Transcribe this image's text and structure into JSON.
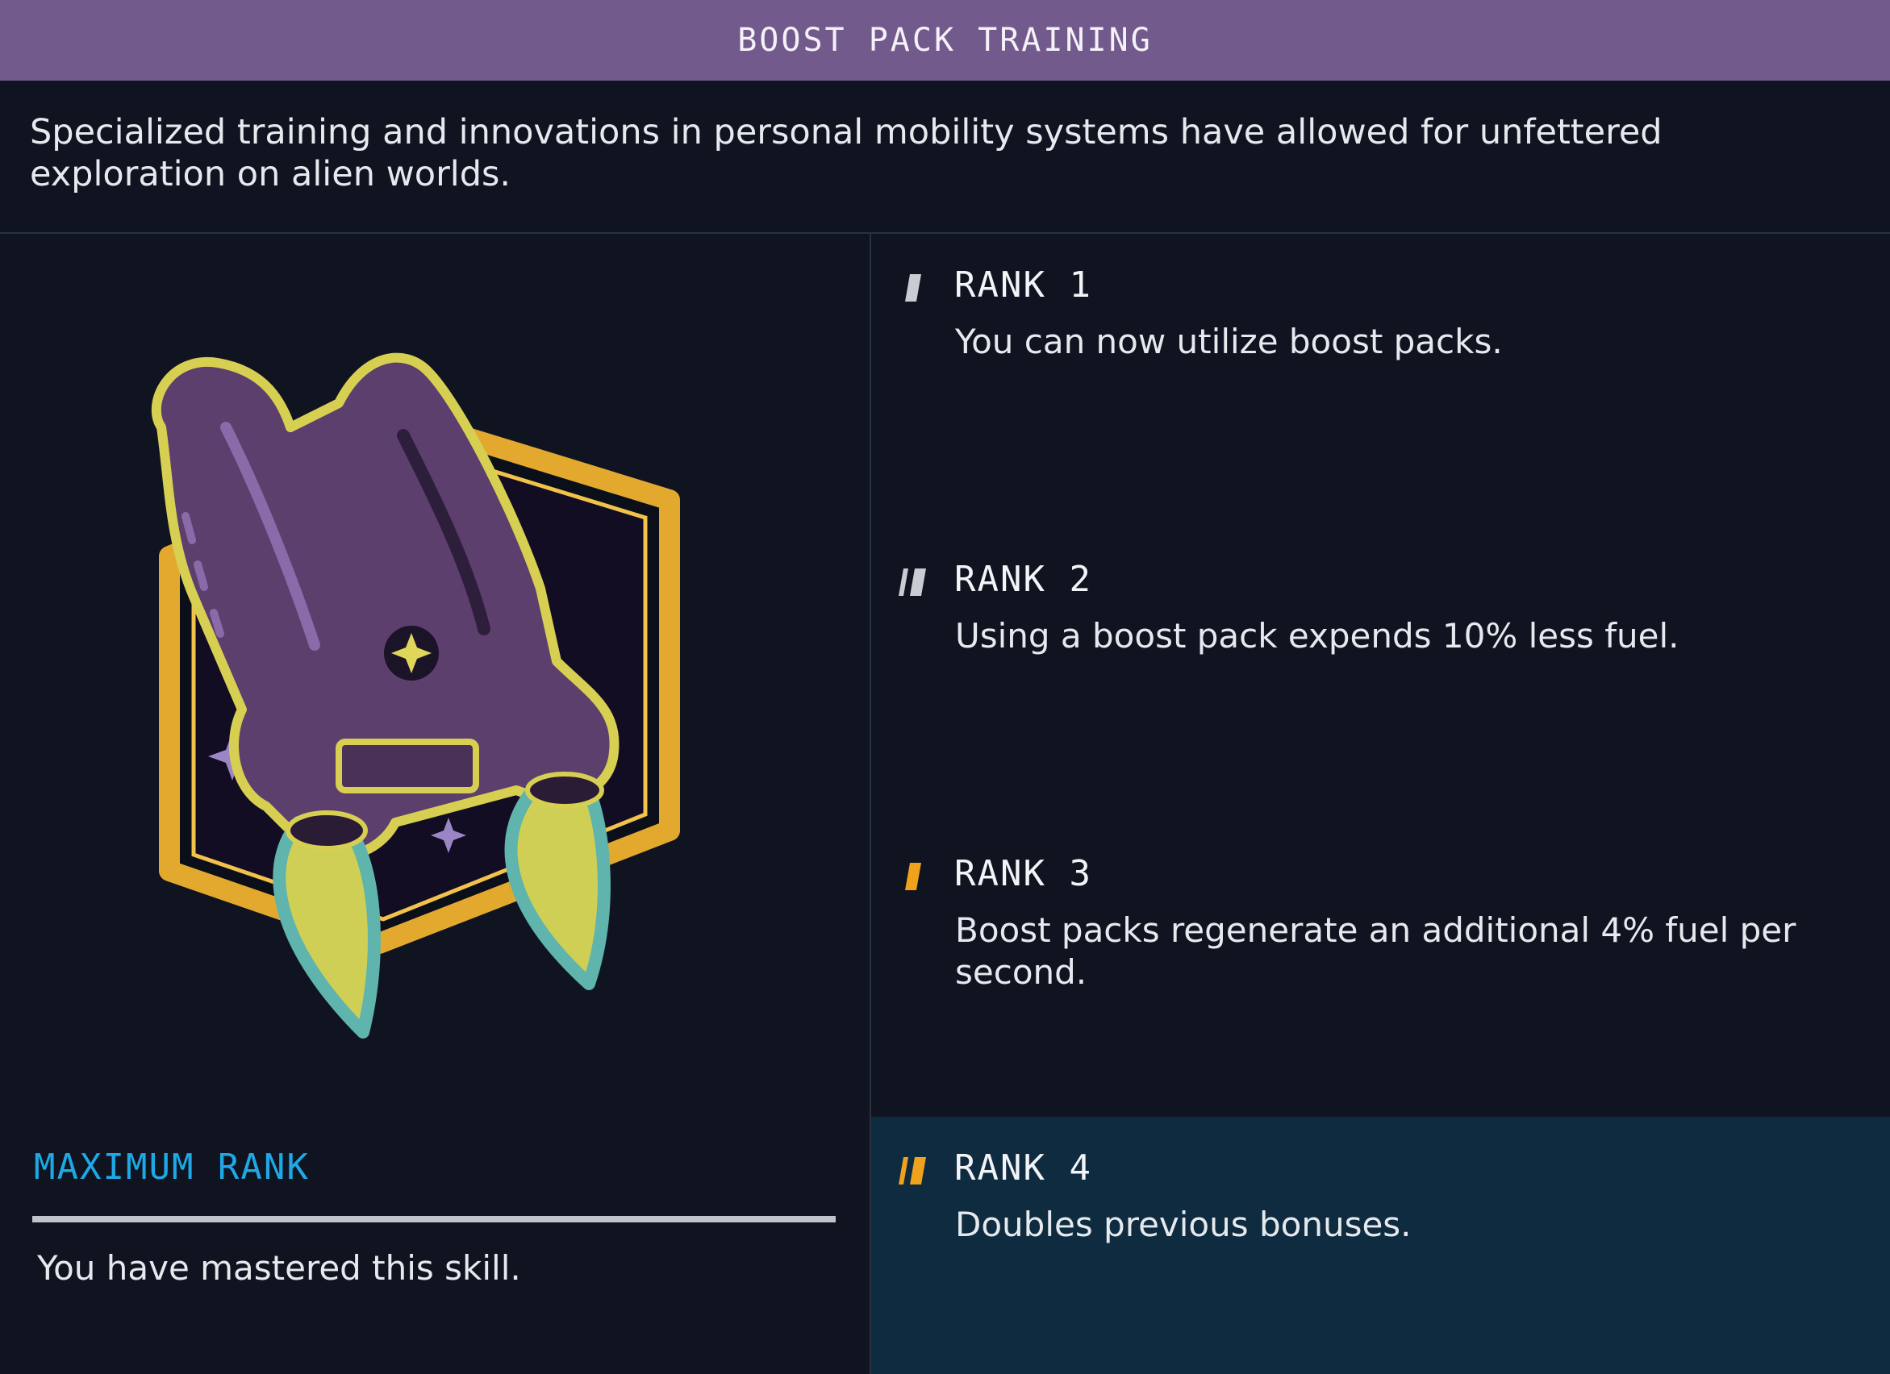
{
  "header": {
    "title": "BOOST PACK TRAINING"
  },
  "description": "Specialized training and innovations in personal mobility systems have allowed for unfettered exploration on alien worlds.",
  "status": {
    "title": "MAXIMUM RANK",
    "text": "You have mastered this skill.",
    "progress_fraction": 1.0
  },
  "ranks": [
    {
      "title": "RANK 1",
      "description": "You can now utilize boost packs.",
      "icon": "rank-1-icon",
      "color": "#c9ccd2"
    },
    {
      "title": "RANK 2",
      "description": "Using a boost pack expends 10% less fuel.",
      "icon": "rank-2-icon",
      "color": "#c9ccd2"
    },
    {
      "title": "RANK 3",
      "description": "Boost packs regenerate an additional 4% fuel per second.",
      "icon": "rank-3-icon",
      "color": "#f0a21c"
    },
    {
      "title": "RANK 4",
      "description": "Doubles previous bonuses.",
      "icon": "rank-4-icon",
      "color": "#f0a21c"
    }
  ],
  "emblem": {
    "icon": "boost-pack-emblem-icon"
  },
  "colors": {
    "header_bg": "#725a8c",
    "accent_blue": "#1ea9e6",
    "rank_gold": "#f0a21c",
    "active_rank_bg": "#0e2b40",
    "background": "#0f1420"
  }
}
